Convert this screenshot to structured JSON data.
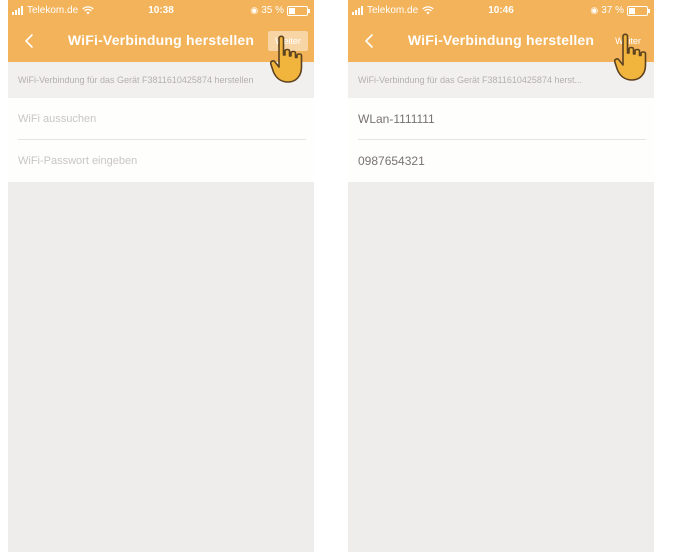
{
  "colors": {
    "header": "#f3b35a",
    "page_background": "#efedeb",
    "form_background": "#fefefd",
    "placeholder_text": "#c9c6c2",
    "value_text": "#777370",
    "hand_fill": "#f1b43d"
  },
  "icons": {
    "back": "chevron-left-icon",
    "pointer": "hand-pointer-icon",
    "signal": "signal-icon",
    "wifi": "wifi-icon",
    "alarm": "alarm-icon",
    "battery": "battery-icon"
  },
  "screens": [
    {
      "status": {
        "carrier": "Telekom.de",
        "time": "10:38",
        "battery": "35 %",
        "battery_level": 0.35
      },
      "header": {
        "title": "WiFi-Verbindung herstellen",
        "next_label": "Weiter"
      },
      "info_text": "WiFi-Verbindung für das Gerät F3811610425874 herstellen",
      "fields": {
        "ssid": {
          "placeholder": "WiFi aussuchen",
          "value": ""
        },
        "password": {
          "placeholder": "WiFi-Passwort eingeben",
          "value": ""
        }
      }
    },
    {
      "status": {
        "carrier": "Telekom.de",
        "time": "10:46",
        "battery": "37 %",
        "battery_level": 0.37
      },
      "header": {
        "title": "WiFi-Verbindung herstellen",
        "next_label": "Weiter"
      },
      "info_text": "WiFi-Verbindung für das Gerät F3811610425874 herst...",
      "fields": {
        "ssid": {
          "placeholder": "",
          "value": "WLan-1111111"
        },
        "password": {
          "placeholder": "",
          "value": "0987654321"
        }
      }
    }
  ]
}
